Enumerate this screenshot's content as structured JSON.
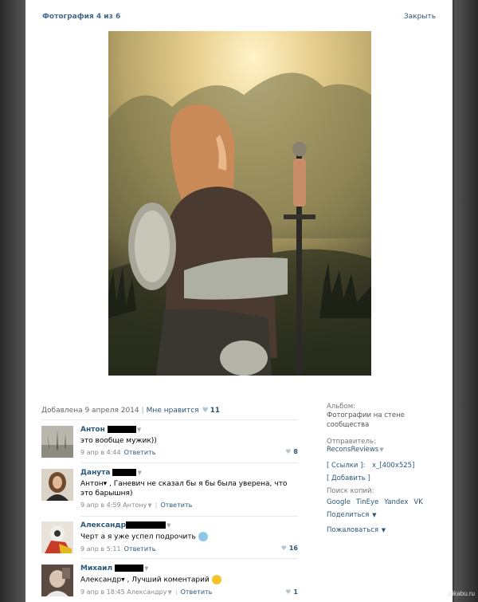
{
  "viewer": {
    "title": "Фотография 4 из 6",
    "close": "Закрыть"
  },
  "meta": {
    "added_label": "Добавлена 9 апреля 2014",
    "like_label": "Мне нравится",
    "like_count": "11"
  },
  "comments": [
    {
      "name": "Антон",
      "text": "это вообще мужик))",
      "date": "9 апр в 4:44",
      "reply_to": "",
      "reply": "Ответить",
      "likes": "8"
    },
    {
      "name": "Данута",
      "text": "Антон▾ , Ганевич не сказал бы я бы была уверена, что это барышня)",
      "date": "9 апр в 4:59",
      "reply_to": "Антону",
      "reply": "Ответить",
      "likes": ""
    },
    {
      "name": "Александр",
      "text": "Черт а я уже успел подрочить",
      "date": "9 апр в 5:11",
      "reply_to": "",
      "reply": "Ответить",
      "likes": "16"
    },
    {
      "name": "Михаил",
      "text": "Александр▾ , Лучший коментарий",
      "date": "9 апр в 18:45",
      "reply_to": "Александру",
      "reply": "Ответить",
      "likes": "1"
    }
  ],
  "sidebar": {
    "album_label": "Альбом:",
    "album_value": "Фотографии на стене сообщества",
    "sender_label": "Отправитель:",
    "sender_value": "ReconsReviews",
    "links_label": "[ Ссылки ]:",
    "links_value": "x_[400x525]",
    "add_label": "[ Добавить ]",
    "search_label": "Поиск копий:",
    "search_engines": [
      "Google",
      "TinEye",
      "Yandex",
      "VK"
    ],
    "share": "Поделиться",
    "report": "Пожаловаться"
  },
  "watermark": "pikabu.ru",
  "colors": {
    "link": "#2b587a",
    "title": "#45688e",
    "backdrop": "#3a3a3a"
  }
}
